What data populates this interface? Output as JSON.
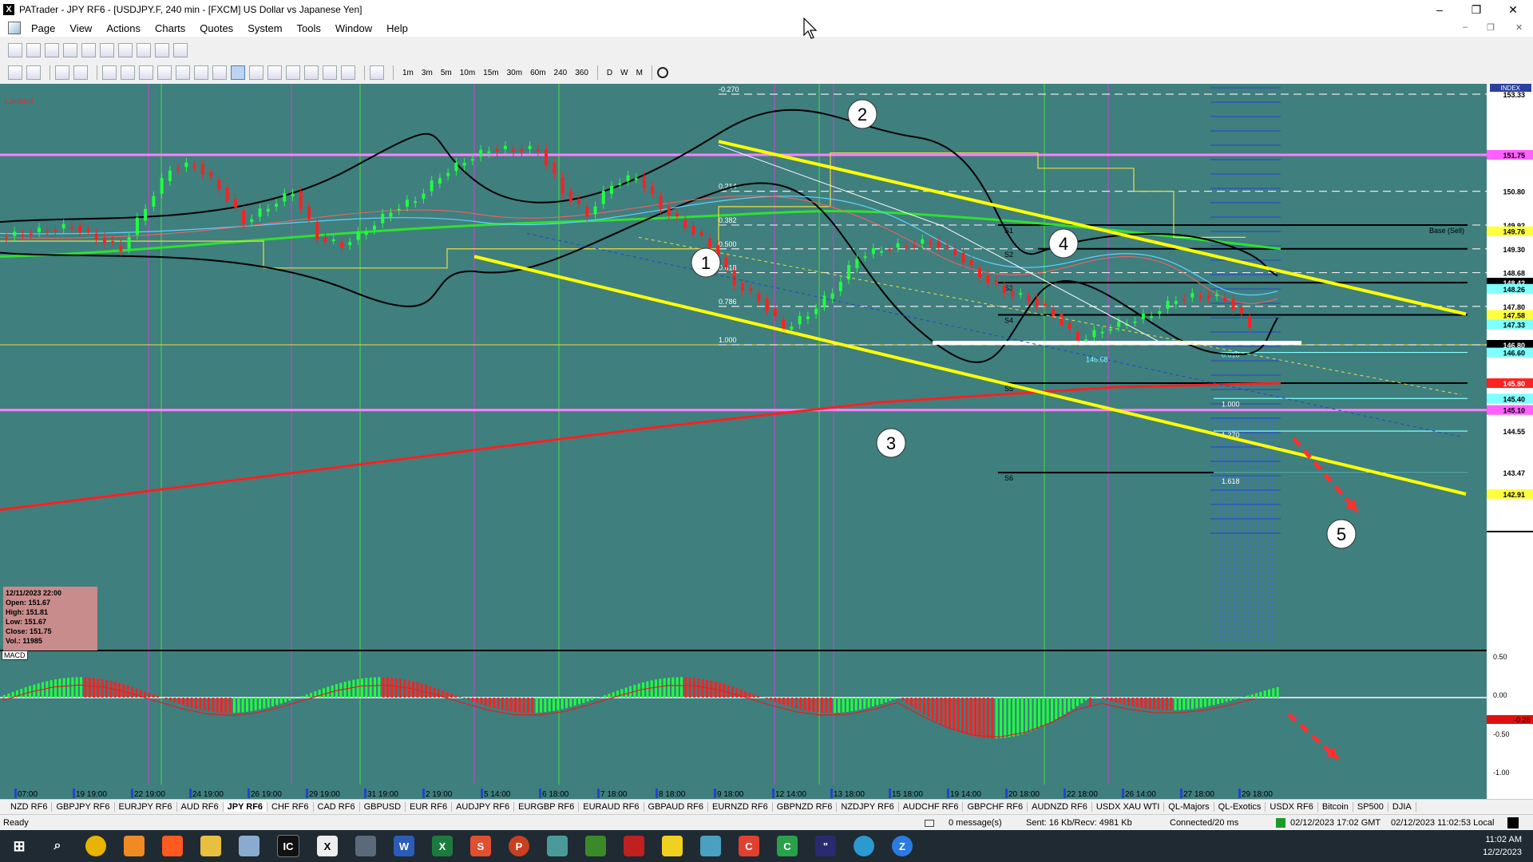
{
  "window": {
    "title": "PATrader - JPY RF6 - [USDJPY.F, 240 min - [FXCM] US Dollar vs Japanese Yen]",
    "minimize": "–",
    "maximize": "❐",
    "close": "✕"
  },
  "menu": [
    "Page",
    "View",
    "Actions",
    "Charts",
    "Quotes",
    "System",
    "Tools",
    "Window",
    "Help"
  ],
  "timeframes": [
    "1m",
    "3m",
    "5m",
    "10m",
    "15m",
    "30m",
    "60m",
    "240",
    "360",
    "D",
    "W",
    "M"
  ],
  "chart": {
    "locked_label": "Locked",
    "macd_label": "MACD",
    "ohlc": {
      "date": "12/11/2023 22:00",
      "open": "Open: 151.67",
      "high": "High: 151.81",
      "low": "Low: 151.67",
      "close": "Close: 151.75",
      "vol": "Vol.: 11985"
    },
    "index_label": "INDEX",
    "price_labels": [
      "153.33",
      "151.75",
      "150.80",
      "149.92",
      "149.76",
      "149.30",
      "148.68",
      "148.42",
      "148.26",
      "147.80",
      "147.58",
      "147.33",
      "146.80",
      "146.60",
      "145.80",
      "145.40",
      "145.10",
      "144.55",
      "143.47",
      "142.91"
    ],
    "fib_labels": [
      "-0.270",
      "0.214",
      "0.382",
      "0.500",
      "0.618",
      "0.786",
      "1.000"
    ],
    "fib_labels_right": [
      "1.000",
      "1.270",
      "1.618",
      "0.618"
    ],
    "pivot_labels": [
      "S1",
      "S2",
      "S3",
      "S4",
      "S5",
      "S6"
    ],
    "base_label": "Base (Sell)",
    "level_label": "146.68",
    "circle_labels": [
      "1",
      "2",
      "3",
      "4",
      "5"
    ],
    "macd_scale": [
      "0.50",
      "0.00",
      "-0.50",
      "-1.00"
    ],
    "macd_value": "-0.26",
    "x_labels": [
      "07:00",
      "19 19:00",
      "22 19:00",
      "24 19:00",
      "26 19:00",
      "29 19:00",
      "31 19:00",
      "2 19:00",
      "5 14:00",
      "6 18:00",
      "7 18:00",
      "8 18:00",
      "9 18:00",
      "12 14:00",
      "13 18:00",
      "15 18:00",
      "19 14:00",
      "20 18:00",
      "22 18:00",
      "26 14:00",
      "27 18:00",
      "29 18:00"
    ]
  },
  "chart_data": {
    "type": "candlestick",
    "symbol": "USDJPY.F",
    "timeframe": "240 min",
    "y_axis_labels": [
      153.33,
      151.75,
      150.8,
      149.92,
      149.76,
      149.3,
      148.68,
      148.42,
      148.26,
      147.8,
      147.58,
      147.33,
      146.8,
      146.6,
      145.8,
      145.4,
      145.1,
      144.55,
      143.47,
      142.91
    ],
    "macd_axis_labels": [
      0.5,
      0.0,
      -0.5,
      -1.0
    ],
    "x_tick_labels": [
      "07:00",
      "19 19:00",
      "22 19:00",
      "24 19:00",
      "26 19:00",
      "29 19:00",
      "31 19:00",
      "2 19:00",
      "5 14:00",
      "6 18:00",
      "7 18:00",
      "8 18:00",
      "9 18:00",
      "12 14:00",
      "13 18:00",
      "15 18:00",
      "19 14:00",
      "20 18:00",
      "22 18:00",
      "26 14:00",
      "27 18:00",
      "29 18:00"
    ],
    "close_path_approx": [
      149.6,
      149.7,
      149.8,
      149.9,
      149.6,
      149.3,
      150.4,
      151.4,
      151.5,
      150.9,
      150.0,
      150.4,
      150.8,
      149.6,
      149.4,
      149.8,
      150.3,
      150.6,
      151.2,
      151.6,
      151.9,
      151.9,
      151.9,
      150.8,
      150.2,
      151.0,
      151.2,
      150.4,
      149.9,
      149.4,
      148.4,
      148.0,
      147.2,
      147.6,
      148.2,
      149.1,
      149.3,
      149.4,
      149.5,
      149.2,
      148.6,
      148.2,
      148.0,
      147.6,
      146.9,
      147.2,
      147.4,
      147.6,
      148.0,
      148.1,
      148.0,
      147.3
    ]
  },
  "tabs": [
    "NZD RF6",
    "GBPJPY RF6",
    "EURJPY RF6",
    "AUD RF6",
    "JPY RF6",
    "CHF RF6",
    "CAD RF6",
    "GBPUSD",
    "EUR RF6",
    "AUDJPY RF6",
    "EURGBP RF6",
    "EURAUD RF6",
    "GBPAUD RF6",
    "EURNZD RF6",
    "GBPNZD RF6",
    "NZDJPY RF6",
    "AUDCHF RF6",
    "GBPCHF RF6",
    "AUDNZD RF6",
    "USDX XAU WTI",
    "QL-Majors",
    "QL-Exotics",
    "USDX RF6",
    "Bitcoin",
    "SP500",
    "DJIA"
  ],
  "active_tab": "JPY RF6",
  "status": {
    "ready": "Ready",
    "messages": "0 message(s)",
    "traffic": "Sent: 16 Kb/Recv: 4981 Kb",
    "connection": "Connected/20 ms",
    "gmt": "02/12/2023 17:02 GMT",
    "local": "02/12/2023 11:02:53 Local"
  },
  "taskbar": {
    "time": "11:02 AM",
    "date": "12/2/2023"
  }
}
